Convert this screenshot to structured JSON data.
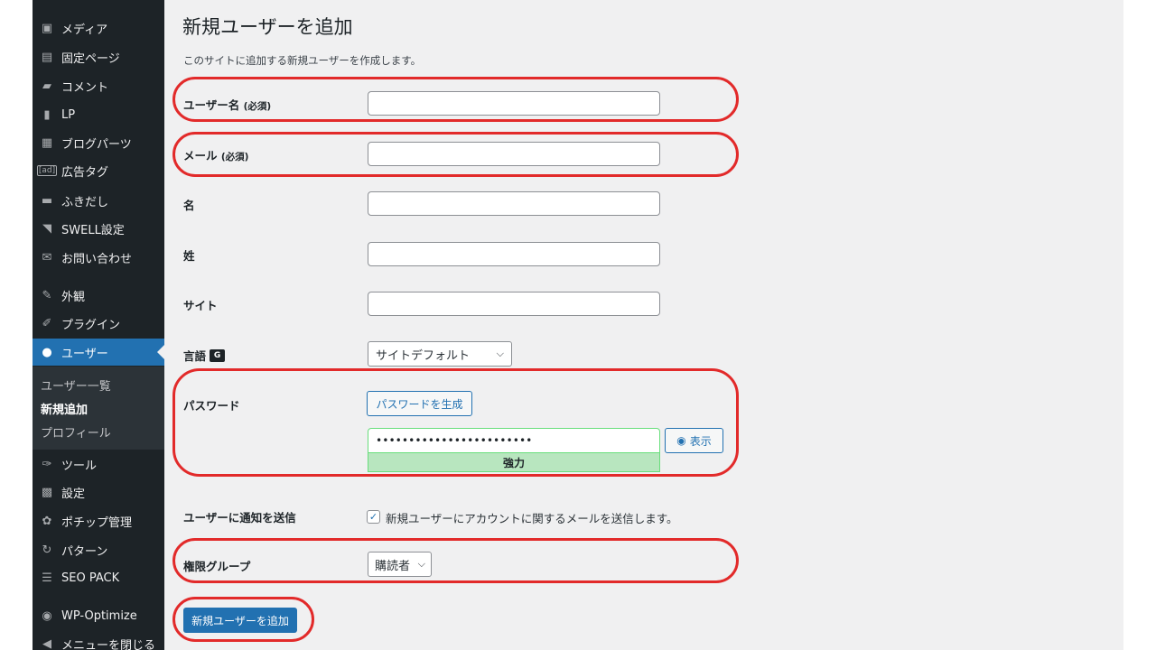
{
  "sidebar": {
    "items": [
      {
        "label": "メディア",
        "icon": "media-icon"
      },
      {
        "label": "固定ページ",
        "icon": "page-icon"
      },
      {
        "label": "コメント",
        "icon": "comment-icon"
      },
      {
        "label": "LP",
        "icon": "lp-icon"
      },
      {
        "label": "ブログパーツ",
        "icon": "blog-parts-icon"
      },
      {
        "label": "広告タグ",
        "icon": "ad-icon",
        "icon_text": "[ad]"
      },
      {
        "label": "ふきだし",
        "icon": "speech-bubble-icon"
      },
      {
        "label": "SWELL設定",
        "icon": "swell-icon"
      },
      {
        "label": "お問い合わせ",
        "icon": "mail-icon"
      },
      {
        "label": "外観",
        "icon": "appearance-icon"
      },
      {
        "label": "プラグイン",
        "icon": "plugin-icon"
      },
      {
        "label": "ユーザー",
        "icon": "user-icon"
      },
      {
        "label": "ツール",
        "icon": "wrench-icon"
      },
      {
        "label": "設定",
        "icon": "settings-icon"
      },
      {
        "label": "ポチップ管理",
        "icon": "paw-icon"
      },
      {
        "label": "パターン",
        "icon": "pattern-icon"
      },
      {
        "label": "SEO PACK",
        "icon": "seo-pack-icon"
      },
      {
        "label": "WP-Optimize",
        "icon": "wp-optimize-icon"
      },
      {
        "label": "メニューを閉じる",
        "icon": "collapse-menu-icon"
      }
    ],
    "active_index": 11,
    "submenu": [
      {
        "label": "ユーザー一覧"
      },
      {
        "label": "新規追加",
        "current": true
      },
      {
        "label": "プロフィール"
      }
    ]
  },
  "main": {
    "title": "新規ユーザーを追加",
    "description": "このサイトに追加する新規ユーザーを作成します。",
    "fields": {
      "username": {
        "label": "ユーザー名",
        "required": "(必須)",
        "value": ""
      },
      "email": {
        "label": "メール",
        "required": "(必須)",
        "value": ""
      },
      "first_name": {
        "label": "名",
        "value": ""
      },
      "last_name": {
        "label": "姓",
        "value": ""
      },
      "website": {
        "label": "サイト",
        "value": ""
      },
      "language": {
        "label": "言語",
        "selected": "サイトデフォルト"
      },
      "password": {
        "label": "パスワード",
        "generate_label": "パスワードを生成",
        "value": "••••••••••••••••••••••••",
        "show_label": "表示",
        "strength": "強力"
      },
      "notify": {
        "label": "ユーザーに通知を送信",
        "checked": true,
        "text": "新規ユーザーにアカウントに関するメールを送信します。"
      },
      "role": {
        "label": "権限グループ",
        "selected": "購読者"
      }
    },
    "submit_label": "新規ユーザーを追加"
  },
  "colors": {
    "accent": "#2271b1",
    "sidebar_bg": "#1d2327",
    "content_bg": "#f0f0f1",
    "highlight": "#e22a2a",
    "strength_bg": "#b8e6bf"
  }
}
